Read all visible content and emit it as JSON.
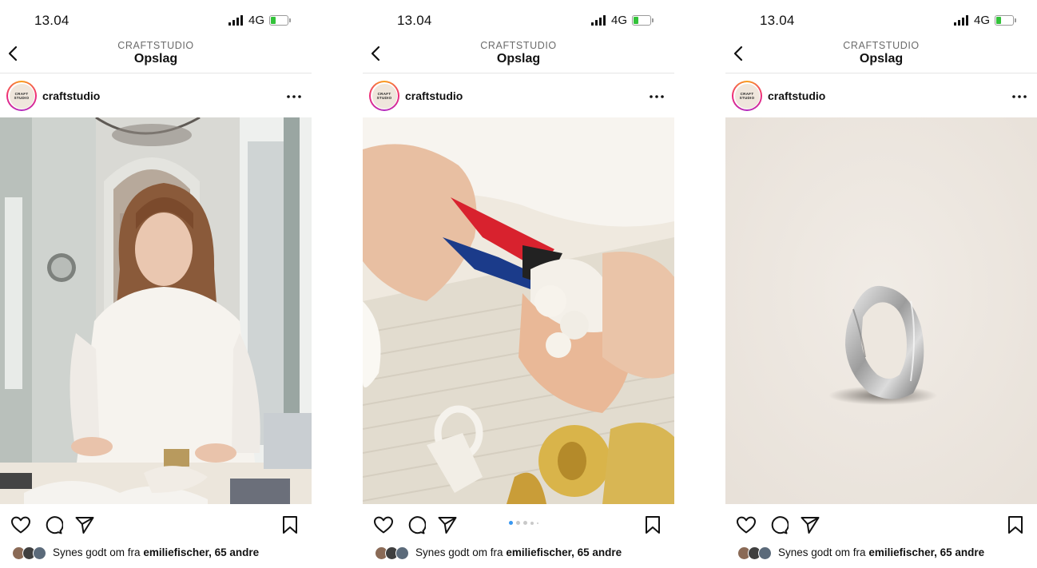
{
  "status_bar": {
    "time": "13.04",
    "network": "4G",
    "battery_fill_fraction": 0.3
  },
  "nav": {
    "subtitle": "CRAFTSTUDIO",
    "title": "Opslag",
    "back_icon": "chevron-left-icon"
  },
  "account": {
    "username": "craftstudio",
    "avatar_text_1": "CRAFT",
    "avatar_text_2": "STUDIO",
    "more_icon": "ellipsis-icon"
  },
  "likes": {
    "prefix": "Synes godt om fra ",
    "user": "emiliefischer",
    "separator": ", ",
    "others": "65 andre"
  },
  "carousel": {
    "slides": 5,
    "active_index": 0,
    "active_color": "#3897f0"
  },
  "actions": [
    "heart-icon",
    "comment-icon",
    "share-icon",
    "bookmark-icon"
  ],
  "posts": [
    {
      "image": "woman-at-table-photo"
    },
    {
      "image": "hands-cutting-wax-ring-photo",
      "has_dots": true
    },
    {
      "image": "silver-ring-product-photo"
    }
  ]
}
